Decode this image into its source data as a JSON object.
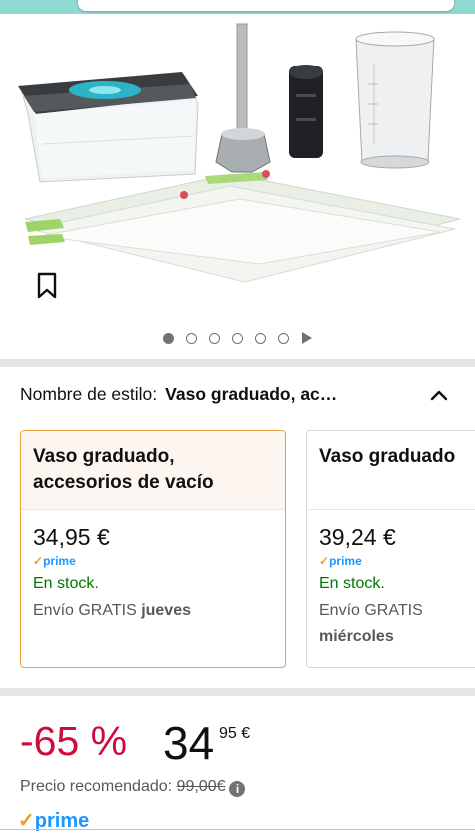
{
  "style_selector": {
    "label": "Nombre de estilo:",
    "value": "Vaso graduado, ac…"
  },
  "options": [
    {
      "title_line1": "Vaso graduado,",
      "title_line2": "accesorios de vacío",
      "price": "34,95 €",
      "prime": "prime",
      "stock": "En stock.",
      "shipping_prefix": "Envío GRATIS",
      "shipping_day": "jueves",
      "selected": true
    },
    {
      "title_line1": "Vaso graduado",
      "title_line2": "",
      "price": "39,24 €",
      "prime": "prime",
      "stock": "En stock.",
      "shipping_prefix": "Envío GRATIS",
      "shipping_day": "miércoles",
      "selected": false
    }
  ],
  "pricing": {
    "discount": "-65 %",
    "price_whole": "34",
    "price_cents_currency": "95 €",
    "recommended_label": "Precio recomendado:",
    "recommended_value": "99,00€"
  },
  "prime_badge": "prime",
  "gallery": {
    "dots_count": 6,
    "active_index": 0
  },
  "colors": {
    "discount": "#cc0c39",
    "stock": "#007600",
    "prime_blue": "#1a98ff",
    "prime_check": "#f59a23",
    "selected_border": "#e8a53c"
  }
}
